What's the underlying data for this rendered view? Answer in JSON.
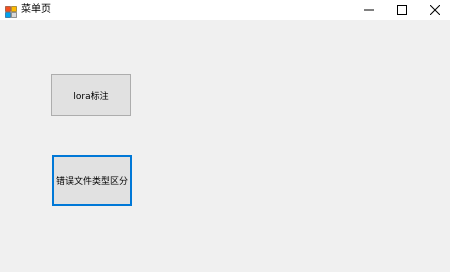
{
  "window": {
    "title": "菜单页",
    "app_icon": "winforms-app-icon",
    "controls": {
      "minimize_icon": "minimize-icon",
      "maximize_icon": "maximize-icon",
      "close_icon": "close-icon"
    }
  },
  "buttons": {
    "lora_label": "lora标注",
    "error_label": "错误文件类型区分"
  },
  "colors": {
    "window_background": "#f0f0f0",
    "titlebar_background": "#ffffff",
    "button_face": "#e1e1e1",
    "button_border": "#adadad",
    "focus_border": "#0078d7"
  }
}
